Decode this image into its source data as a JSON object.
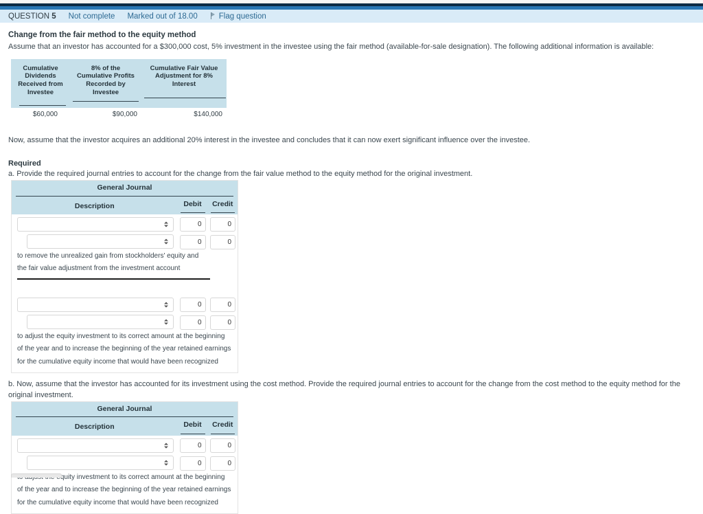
{
  "header": {
    "question_label": "QUESTION",
    "question_number": "5",
    "status": "Not complete",
    "marks": "Marked out of 18.00",
    "flag_label": "Flag question",
    "flag_icon": "flag-icon",
    "colors": {
      "navy": "#0d2b45",
      "blue": "#2a77b5",
      "info_bar": "#d9ebf7",
      "table_header": "#c6e0ea"
    }
  },
  "question": {
    "title": "Change from the fair method to the equity method",
    "intro": "Assume that an investor has accounted for a $300,000 cost, 5% investment in the investee using the fair method (available-for-sale designation). The following additional information is available:",
    "followup": "Now, assume that the investor acquires an additional 20% interest in the investee and concludes that it can now exert significant influence over the investee.",
    "required_heading": "Required",
    "part_a": "a. Provide the required journal entries to account for the change from the fair value method to the equity method for the original investment.",
    "part_b": "b. Now, assume that the investor has accounted for its investment using the cost method. Provide the required journal entries to account for the change from the cost method to the equity method for the original investment."
  },
  "info_table": {
    "headers": [
      "Cumulative Dividends Received from Investee",
      "8% of the Cumulative Profits Recorded by Investee",
      "Cumulative Fair Value Adjustment for 8% Interest"
    ],
    "values": [
      "$60,000",
      "$90,000",
      "$140,000"
    ]
  },
  "journal_a": {
    "title": "General Journal",
    "columns": [
      "Description",
      "Debit",
      "Credit"
    ],
    "rows": [
      {
        "select_value": "",
        "debit": "0",
        "credit": "0",
        "indent": false
      },
      {
        "select_value": "",
        "debit": "0",
        "credit": "0",
        "indent": true
      }
    ],
    "note_lines": [
      "to remove the unrealized gain from stockholders' equity and",
      "the fair value adjustment from the investment account"
    ],
    "rows2": [
      {
        "select_value": "",
        "debit": "0",
        "credit": "0",
        "indent": false
      },
      {
        "select_value": "",
        "debit": "0",
        "credit": "0",
        "indent": true
      }
    ],
    "note_lines2": [
      "to adjust the equity investment to its correct amount at the beginning",
      "of the year and to increase the beginning of the year retained earnings",
      "for the cumulative equity income that would have been recognized"
    ]
  },
  "journal_b": {
    "title": "General Journal",
    "columns": [
      "Description",
      "Debit",
      "Credit"
    ],
    "rows": [
      {
        "select_value": "",
        "debit": "0",
        "credit": "0",
        "indent": false
      },
      {
        "select_value": "",
        "debit": "0",
        "credit": "0",
        "indent": true
      }
    ],
    "note_lines": [
      "to adjust the equity investment to its correct amount at the beginning",
      "of the year and to increase the beginning of the year retained earnings",
      "for the cumulative equity income that would have been recognized"
    ]
  }
}
